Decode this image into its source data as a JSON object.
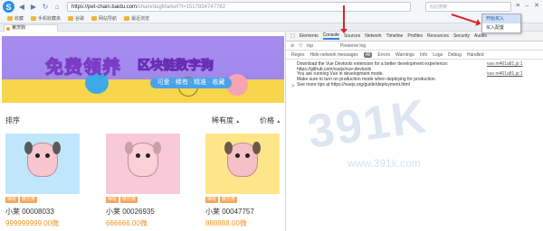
{
  "browser": {
    "url_host": "https://pet-chain.baidu.com",
    "url_rest": "/chain/dogMarket?t=1517834747782",
    "search_placeholder": "点此搜索",
    "bookmarks": [
      "收藏",
      "手机收藏夹",
      "谷歌",
      "网站导航",
      "最近浏览"
    ],
    "tab_title": "莱茨狗"
  },
  "banner": {
    "title": "免费领养",
    "title2": "区块链数字狗",
    "button": "可爱 · 稀有 · 精准 · 收藏"
  },
  "filters": {
    "sort": "排序",
    "generation": "稀有度",
    "price": "价格"
  },
  "cards": [
    {
      "name": "小莱 00008033",
      "price": "999999999.00微",
      "tags": [
        "稀有",
        "微付券"
      ],
      "bg": "#bfe6fb",
      "pet": "#f7c2cc"
    },
    {
      "name": "小莱 00026935",
      "price": "666666.00微",
      "tags": [
        "稀有",
        "微付券"
      ],
      "bg": "#f7c9d9",
      "pet": "#f7c2cc"
    },
    {
      "name": "小莱 00047757",
      "price": "888888.00微",
      "tags": [
        "稀有",
        "微付券"
      ],
      "bg": "#fde58a",
      "pet": "#f7c2cc"
    }
  ],
  "devtools": {
    "tabs": [
      "Elements",
      "Console",
      "Sources",
      "Network",
      "Timeline",
      "Profiles",
      "Resources",
      "Security",
      "Audits"
    ],
    "active_tab": "Console",
    "context": "top",
    "preserve": "Preserve log",
    "options": [
      "Regex",
      "Hide network messages",
      "All",
      "Errors",
      "Warnings",
      "Info",
      "Logs",
      "Debug",
      "Handled"
    ],
    "logs": [
      {
        "text": "Download the Vue Devtools extension for a better development experience:",
        "text2": "https://github.com/vuejs/vue-devtools",
        "src": "vue.m461a81.js:1"
      },
      {
        "text": "You are running Vue in development mode.",
        "text2": "Make sure to turn on production mode when deploying for production.",
        "text3": "See more tips at https://vuejs.org/guide/deployment.html",
        "src": "vue.m461a81.js:1"
      }
    ],
    "prompt": ">"
  },
  "context_menu": {
    "items": [
      "开始买入",
      "买入配置"
    ]
  },
  "watermark": "391K",
  "watermark_url": "www.391k.com"
}
